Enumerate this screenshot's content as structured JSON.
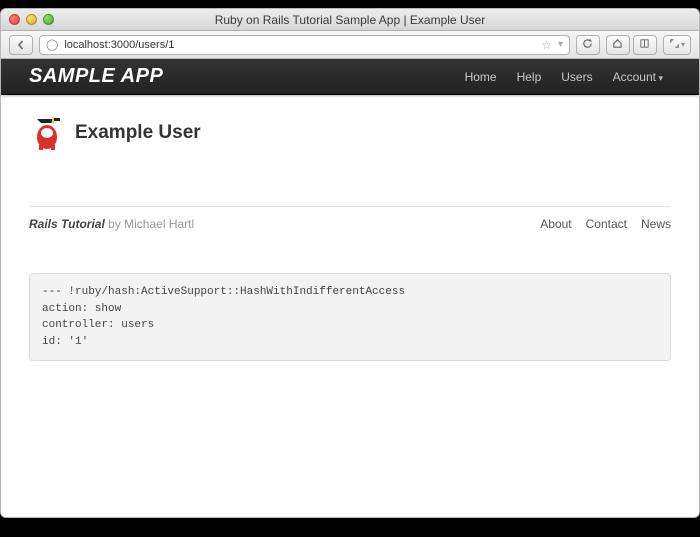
{
  "window": {
    "title": "Ruby on Rails Tutorial Sample App | Example User",
    "url": "localhost:3000/users/1"
  },
  "navbar": {
    "brand": "SAMPLE APP",
    "links": [
      {
        "label": "Home"
      },
      {
        "label": "Help"
      },
      {
        "label": "Users"
      },
      {
        "label": "Account",
        "caret": true
      }
    ]
  },
  "user": {
    "name": "Example User"
  },
  "footer": {
    "site": "Rails Tutorial",
    "byline": "by Michael Hartl",
    "links": [
      {
        "label": "About"
      },
      {
        "label": "Contact"
      },
      {
        "label": "News"
      }
    ]
  },
  "debug": {
    "line0": "--- !ruby/hash:ActiveSupport::HashWithIndifferentAccess",
    "line1": "action: show",
    "line2": "controller: users",
    "line3": "id: '1'"
  }
}
